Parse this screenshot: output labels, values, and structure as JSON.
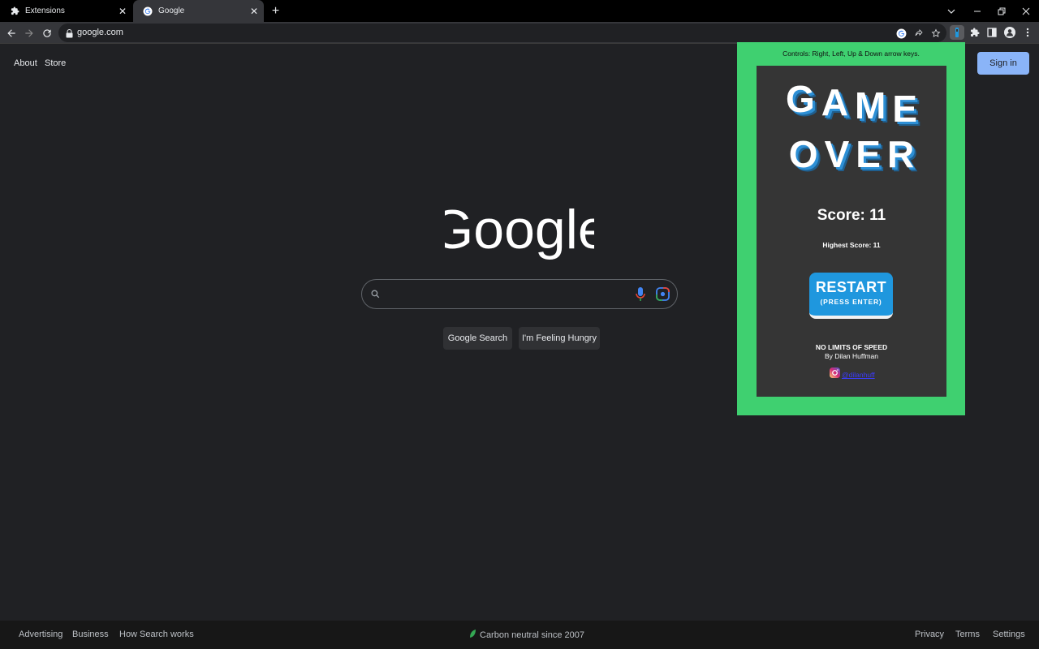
{
  "tabs": [
    {
      "title": "Extensions",
      "icon": "puzzle-icon"
    },
    {
      "title": "Google",
      "icon": "google-g-icon"
    }
  ],
  "address_bar": {
    "url": "google.com"
  },
  "page": {
    "top_links": [
      "About",
      "Store"
    ],
    "sign_in": "Sign in",
    "logo_text": "Google",
    "search_placeholder": "",
    "buttons": {
      "search": "Google Search",
      "lucky": "I'm Feeling Hungry"
    }
  },
  "footer": {
    "left_links": [
      "Advertising",
      "Business",
      "How Search works"
    ],
    "center": "Carbon neutral since 2007",
    "right_links": [
      "Privacy",
      "Terms",
      "Settings"
    ]
  },
  "popup": {
    "controls_text": "Controls: Right, Left, Up & Down arrow keys.",
    "game_over_line1": "GAME",
    "game_over_line2": "OVER",
    "score": "Score: 11",
    "highest_score": "Highest Score: 11",
    "restart_label": "RESTART",
    "restart_hint": "(PRESS ENTER)",
    "title": "NO LIMITS OF SPEED",
    "author": "By Dilan Huffman",
    "instagram_handle": "@dilanhuff"
  },
  "colors": {
    "page_bg": "#202124",
    "popup_border": "#3fd070",
    "game_bg": "#353535",
    "restart_button": "#1f97de",
    "sign_in_button": "#8ab4f8"
  }
}
